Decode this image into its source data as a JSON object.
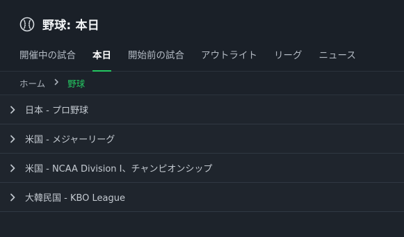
{
  "header": {
    "icon": "baseball-icon",
    "title": "野球: 本日"
  },
  "tabs": [
    {
      "label": "開催中の試合",
      "active": false
    },
    {
      "label": "本日",
      "active": true
    },
    {
      "label": "開始前の試合",
      "active": false
    },
    {
      "label": "アウトライト",
      "active": false
    },
    {
      "label": "リーグ",
      "active": false
    },
    {
      "label": "ニュース",
      "active": false
    }
  ],
  "breadcrumb": {
    "home": "ホーム",
    "separator_icon": "chevron-right-icon",
    "current": "野球"
  },
  "leagues": [
    {
      "label": "日本 - プロ野球"
    },
    {
      "label": "米国 - メジャーリーグ"
    },
    {
      "label": "米国 - NCAA Division I、チャンピオンシップ"
    },
    {
      "label": "大韓民国 - KBO League"
    }
  ],
  "colors": {
    "accent": "#24c761",
    "background": "#1d232b"
  }
}
